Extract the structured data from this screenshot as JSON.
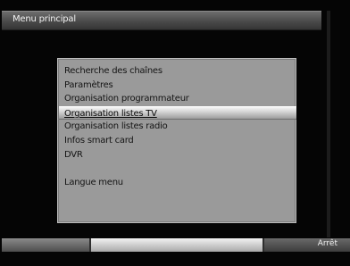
{
  "window": {
    "title": "Menu principal"
  },
  "menu": {
    "items": [
      {
        "label": "Recherche des chaînes"
      },
      {
        "label": "Paramètres"
      },
      {
        "label": "Organisation programmateur"
      },
      {
        "label": "Organisation listes TV",
        "selected": true
      },
      {
        "label": "Organisation listes radio"
      },
      {
        "label": "Infos smart card"
      },
      {
        "label": "DVR"
      },
      {
        "label": ""
      },
      {
        "label": "Langue menu"
      }
    ]
  },
  "footer": {
    "action_label": "Arrêt"
  },
  "colors": {
    "background": "#050505",
    "panel": "#9a9a9a",
    "highlight": "#d8d8d8"
  }
}
